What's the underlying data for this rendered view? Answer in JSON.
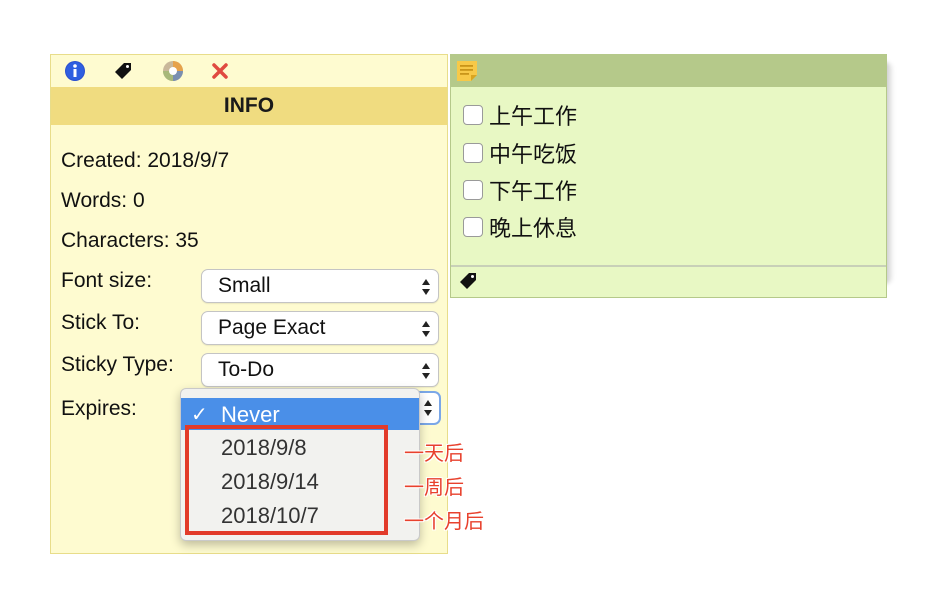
{
  "info_panel": {
    "header": "INFO",
    "created": "Created: 2018/9/7",
    "words": "Words: 0",
    "characters": "Characters: 35",
    "toolbar_icons": [
      "info-icon",
      "tag-icon",
      "color-wheel-icon",
      "close-icon"
    ],
    "fields": {
      "font_size": {
        "label": "Font size:",
        "value": "Small"
      },
      "stick_to": {
        "label": "Stick To:",
        "value": "Page Exact"
      },
      "sticky_type": {
        "label": "Sticky Type:",
        "value": "To-Do"
      },
      "expires": {
        "label": "Expires:"
      }
    }
  },
  "expires_dropdown": {
    "selected": "Never",
    "check_mark": "✓",
    "options": [
      "2018/9/8",
      "2018/9/14",
      "2018/10/7"
    ]
  },
  "annotations": [
    "一天后",
    "一周后",
    "一个月后"
  ],
  "sticky_note": {
    "todos": [
      "上午工作",
      "中午吃饭",
      "下午工作",
      "晚上休息"
    ]
  },
  "colors": {
    "info_bg": "#fefbd0",
    "info_header_bg": "#f0dc80",
    "sticky_bg": "#e8f8c4",
    "sticky_header_bg": "#b5c98a",
    "dropdown_selected_bg": "#4a8fe8",
    "annotation_red": "#e23b2a"
  }
}
